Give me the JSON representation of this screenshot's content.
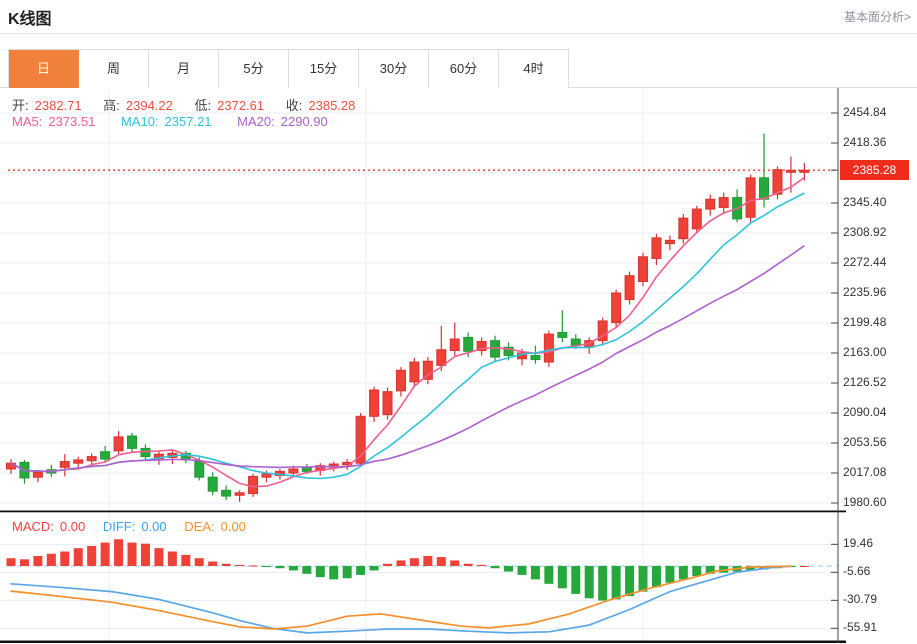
{
  "header": {
    "title": "K线图",
    "link": "基本面分析>"
  },
  "tabs": {
    "items": [
      {
        "label": "日",
        "active": true
      },
      {
        "label": "周",
        "active": false
      },
      {
        "label": "月",
        "active": false
      },
      {
        "label": "5分",
        "active": false
      },
      {
        "label": "15分",
        "active": false
      },
      {
        "label": "30分",
        "active": false
      },
      {
        "label": "60分",
        "active": false
      },
      {
        "label": "4时",
        "active": false
      }
    ]
  },
  "ohlc": {
    "open_label": "开:",
    "open": "2382.71",
    "high_label": "高:",
    "high": "2394.22",
    "low_label": "低:",
    "low": "2372.61",
    "close_label": "收:",
    "close": "2385.28"
  },
  "ma": {
    "ma5_label": "MA5:",
    "ma5": "2373.51",
    "ma10_label": "MA10:",
    "ma10": "2357.21",
    "ma20_label": "MA20:",
    "ma20": "2290.90"
  },
  "macd": {
    "macd_label": "MACD:",
    "macd": "0.00",
    "diff_label": "DIFF:",
    "diff": "0.00",
    "dea_label": "DEA:",
    "dea": "0.00"
  },
  "price_tag": "2385.28",
  "colors": {
    "accent_orange": "#f0813c",
    "candle_up": "#ee4138",
    "candle_up_stroke": "#d53530",
    "candle_down": "#27a83c",
    "candle_down_stroke": "#1d9c31",
    "ma5": "#f05e8e",
    "ma10": "#2ec3dc",
    "ma20": "#b05fd0",
    "diff_line": "#5aa7e8",
    "dea_line": "#f5902c",
    "price_line": "#f3392b",
    "tag_bg": "#f22c1c",
    "grid": "#e9eef4",
    "axis": "#444444",
    "zero_dash": "#9fd8ef"
  },
  "chart_data": [
    {
      "type": "candlestick",
      "title": "K线图 main pane (daily gold candles, 60 periods, x unlabeled)",
      "legend": [
        "MA5",
        "MA10",
        "MA20"
      ],
      "ma_windows": [
        5,
        10,
        20
      ],
      "y_ticks": [
        2454.84,
        2418.36,
        2345.4,
        2308.92,
        2272.44,
        2235.96,
        2199.48,
        2163.0,
        2126.52,
        2090.04,
        2053.56,
        2017.08,
        1980.6
      ],
      "ylim": [
        1967,
        2468
      ],
      "current_price_line": 2385.28,
      "candles_ohlc": [
        [
          2022,
          2034,
          2016,
          2029
        ],
        [
          2030,
          2033,
          2004,
          2011
        ],
        [
          2012,
          2021,
          2006,
          2018
        ],
        [
          2021,
          2027,
          2012,
          2017
        ],
        [
          2024,
          2040,
          2013,
          2031
        ],
        [
          2029,
          2037,
          2023,
          2033
        ],
        [
          2032,
          2041,
          2026,
          2037
        ],
        [
          2043,
          2050,
          2030,
          2034
        ],
        [
          2044,
          2068,
          2040,
          2061
        ],
        [
          2062,
          2066,
          2042,
          2047
        ],
        [
          2047,
          2052,
          2032,
          2037
        ],
        [
          2033,
          2044,
          2027,
          2040
        ],
        [
          2036,
          2045,
          2028,
          2041
        ],
        [
          2041,
          2044,
          2029,
          2033
        ],
        [
          2031,
          2036,
          2008,
          2012
        ],
        [
          2012,
          2018,
          1990,
          1995
        ],
        [
          1996,
          2002,
          1984,
          1989
        ],
        [
          1990,
          1996,
          1982,
          1993
        ],
        [
          1992,
          2016,
          1988,
          2013
        ],
        [
          2012,
          2020,
          2006,
          2016
        ],
        [
          2014,
          2022,
          2009,
          2019
        ],
        [
          2017,
          2026,
          2012,
          2022
        ],
        [
          2024,
          2028,
          2016,
          2019
        ],
        [
          2020,
          2029,
          2014,
          2026
        ],
        [
          2024,
          2031,
          2019,
          2028
        ],
        [
          2027,
          2034,
          2021,
          2030
        ],
        [
          2029,
          2090,
          2025,
          2086
        ],
        [
          2086,
          2122,
          2079,
          2118
        ],
        [
          2088,
          2121,
          2082,
          2116
        ],
        [
          2117,
          2146,
          2110,
          2142
        ],
        [
          2128,
          2157,
          2121,
          2152
        ],
        [
          2131,
          2158,
          2125,
          2153
        ],
        [
          2148,
          2196,
          2141,
          2167
        ],
        [
          2166,
          2200,
          2158,
          2180
        ],
        [
          2182,
          2188,
          2158,
          2165
        ],
        [
          2166,
          2182,
          2160,
          2177
        ],
        [
          2178,
          2184,
          2152,
          2158
        ],
        [
          2170,
          2176,
          2154,
          2160
        ],
        [
          2156,
          2168,
          2148,
          2163
        ],
        [
          2160,
          2172,
          2150,
          2155
        ],
        [
          2152,
          2190,
          2146,
          2186
        ],
        [
          2188,
          2215,
          2176,
          2182
        ],
        [
          2180,
          2186,
          2168,
          2172
        ],
        [
          2170,
          2182,
          2162,
          2178
        ],
        [
          2178,
          2206,
          2172,
          2202
        ],
        [
          2200,
          2240,
          2194,
          2236
        ],
        [
          2228,
          2262,
          2222,
          2257
        ],
        [
          2250,
          2285,
          2244,
          2280
        ],
        [
          2278,
          2308,
          2270,
          2303
        ],
        [
          2296,
          2306,
          2288,
          2300
        ],
        [
          2302,
          2332,
          2296,
          2327
        ],
        [
          2314,
          2342,
          2308,
          2338
        ],
        [
          2338,
          2356,
          2330,
          2350
        ],
        [
          2340,
          2358,
          2332,
          2352
        ],
        [
          2352,
          2362,
          2322,
          2326
        ],
        [
          2328,
          2380,
          2322,
          2376
        ],
        [
          2376,
          2430,
          2340,
          2350
        ],
        [
          2356,
          2390,
          2350,
          2386
        ],
        [
          2384,
          2402,
          2358,
          2385
        ],
        [
          2382.71,
          2394.22,
          2372.61,
          2385.28
        ]
      ]
    },
    {
      "type": "macd",
      "title": "MACD pane",
      "y_ticks": [
        19.46,
        -5.66,
        -30.79,
        -55.91
      ],
      "ylim": [
        -68,
        28
      ],
      "zero_line": 0,
      "histogram": [
        7,
        6,
        9,
        11,
        13,
        16,
        18,
        21,
        24,
        21,
        20,
        16,
        13,
        10,
        7,
        4,
        2,
        1,
        0.5,
        -0.5,
        -2,
        -4,
        -7,
        -10,
        -12,
        -11,
        -8,
        -4,
        2,
        5,
        7,
        9,
        8,
        5,
        2,
        1,
        -2,
        -5,
        -8,
        -12,
        -16,
        -20,
        -25,
        -29,
        -31,
        -30,
        -27,
        -23,
        -19,
        -15,
        -12,
        -9,
        -7,
        -6,
        -5,
        -4,
        -3,
        -2,
        -1,
        0
      ],
      "diff_points": [
        [
          0,
          -16
        ],
        [
          3.5,
          -19
        ],
        [
          7.5,
          -23
        ],
        [
          11,
          -30
        ],
        [
          15,
          -42
        ],
        [
          17,
          -49
        ],
        [
          19.5,
          -56
        ],
        [
          22,
          -60
        ],
        [
          25,
          -58.5
        ],
        [
          28,
          -56.5
        ],
        [
          31,
          -56.5
        ],
        [
          34,
          -58.5
        ],
        [
          37,
          -60
        ],
        [
          40,
          -59
        ],
        [
          43,
          -53
        ],
        [
          46,
          -39
        ],
        [
          49,
          -23
        ],
        [
          52,
          -12.5
        ],
        [
          54,
          -5.5
        ],
        [
          56.5,
          -1.5
        ],
        [
          58,
          -0.2
        ]
      ],
      "dea_points": [
        [
          0,
          -22.5
        ],
        [
          3.5,
          -27
        ],
        [
          7.5,
          -32.5
        ],
        [
          11,
          -40
        ],
        [
          15,
          -50
        ],
        [
          17,
          -54.5
        ],
        [
          19.5,
          -56.5
        ],
        [
          22,
          -54
        ],
        [
          25,
          -45
        ],
        [
          27.5,
          -43
        ],
        [
          30.5,
          -48.5
        ],
        [
          33.5,
          -54
        ],
        [
          35.5,
          -55.5
        ],
        [
          38.5,
          -52
        ],
        [
          41.5,
          -43
        ],
        [
          44.5,
          -30.5
        ],
        [
          47.5,
          -20
        ],
        [
          50.5,
          -11
        ],
        [
          52.5,
          -4.5
        ],
        [
          55,
          -1
        ],
        [
          58,
          -0.2
        ]
      ]
    }
  ]
}
